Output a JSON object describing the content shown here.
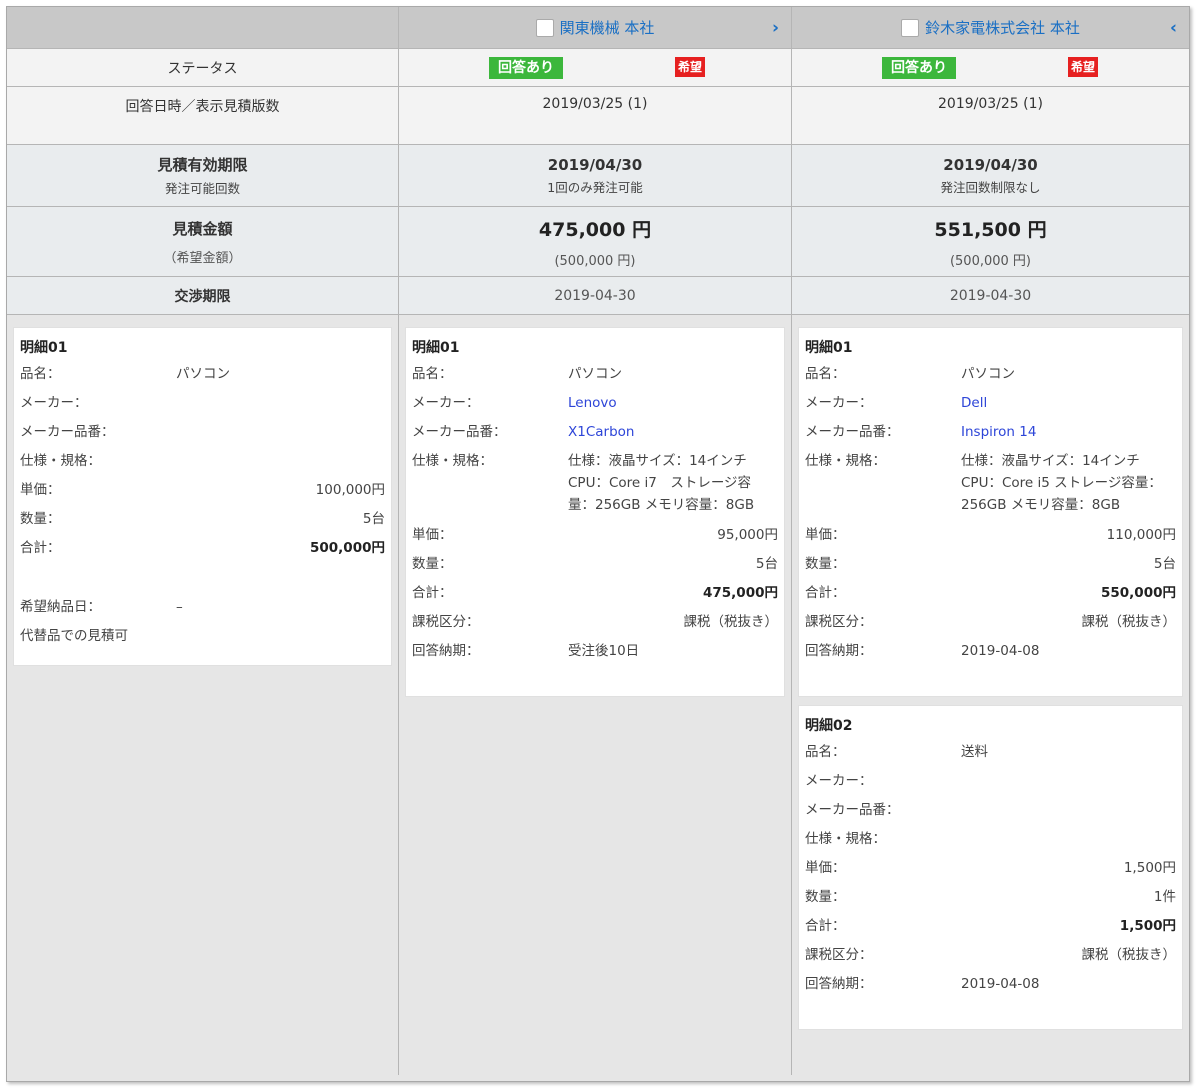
{
  "columns": [
    {
      "company": "",
      "chevron": ""
    },
    {
      "company": "関東機械 本社",
      "chevron": "›"
    },
    {
      "company": "鈴木家電株式会社 本社",
      "chevron": "‹"
    }
  ],
  "labels": {
    "status": "ステータス",
    "date": "回答日時／表示見積版数",
    "valid": "見積有効期限",
    "order_count": "発注可能回数",
    "amount": "見積金額",
    "desired_amount": "（希望金額）",
    "nego": "交渉期限"
  },
  "quotes": [
    {
      "status": "回答あり",
      "hope": "希望",
      "date": "2019/03/25 (1)",
      "valid": "2019/04/30",
      "order_note": "1回のみ発注可能",
      "amount": "475,000 円",
      "desired": "(500,000 円)",
      "nego": "2019-04-30"
    },
    {
      "status": "回答あり",
      "hope": "希望",
      "date": "2019/03/25 (1)",
      "valid": "2019/04/30",
      "order_note": "発注回数制限なし",
      "amount": "551,500 円",
      "desired": "(500,000 円)",
      "nego": "2019-04-30"
    }
  ],
  "field_labels": {
    "name": "品名：",
    "maker": "メーカー：",
    "part": "メーカー品番：",
    "spec": "仕様・規格：",
    "price": "単価：",
    "qty": "数量：",
    "total": "合計：",
    "tax": "課税区分：",
    "delivery": "回答納期：",
    "desired_date": "希望納品日："
  },
  "request": {
    "title": "明細01",
    "name": "パソコン",
    "price": "100,000円",
    "qty": "5台",
    "total": "500,000円",
    "desired_date": "–",
    "substitute": "代替品での見積可"
  },
  "items1": [
    {
      "title": "明細01",
      "name": "パソコン",
      "maker": "Lenovo",
      "part": "X1Carbon",
      "spec": "仕様：液晶サイズ：14インチ CPU：Core i7　ストレージ容量：256GB メモリ容量：8GB",
      "price": "95,000円",
      "qty": "5台",
      "total": "475,000円",
      "tax": "課税（税抜き）",
      "delivery": "受注後10日"
    }
  ],
  "items2": [
    {
      "title": "明細01",
      "name": "パソコン",
      "maker": "Dell",
      "part": "Inspiron 14",
      "spec": "仕様：液晶サイズ：14インチ CPU：Core i5 ストレージ容量：256GB メモリ容量：8GB",
      "price": "110,000円",
      "qty": "5台",
      "total": "550,000円",
      "tax": "課税（税抜き）",
      "delivery": "2019-04-08"
    },
    {
      "title": "明細02",
      "name": "送料",
      "maker": "",
      "part": "",
      "spec": "",
      "price": "1,500円",
      "qty": "1件",
      "total": "1,500円",
      "tax": "課税（税抜き）",
      "delivery": "2019-04-08"
    }
  ]
}
